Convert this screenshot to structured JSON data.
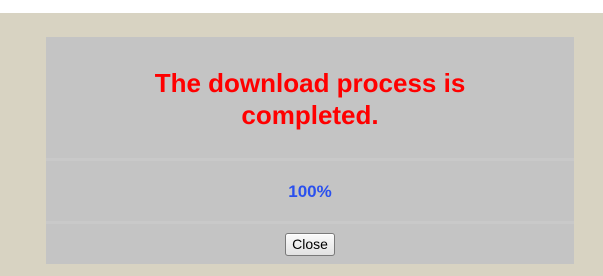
{
  "dialog": {
    "message": "The download process is completed.",
    "progress_text": "100%",
    "progress_fraction": 1.0,
    "close_label": "Close"
  },
  "colors": {
    "background": "#d8d3c2",
    "panel": "#c4c4c4",
    "message": "#ff0000",
    "progress": "#2a50ee"
  }
}
